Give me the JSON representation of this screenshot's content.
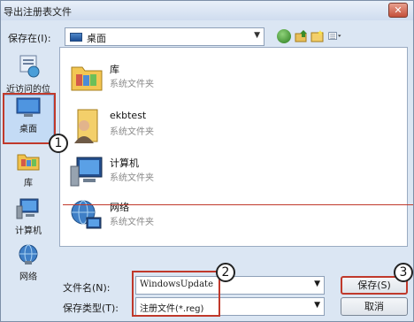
{
  "window": {
    "title": "导出注册表文件"
  },
  "toolbar": {
    "save_in_label": "保存在(I):",
    "save_in_value": "桌面"
  },
  "places": [
    {
      "label": "近访问的位置",
      "icon": "recent-places-icon"
    },
    {
      "label": "桌面",
      "icon": "desktop-icon"
    },
    {
      "label": "库",
      "icon": "library-icon"
    },
    {
      "label": "计算机",
      "icon": "computer-icon"
    },
    {
      "label": "网络",
      "icon": "network-icon"
    }
  ],
  "files": [
    {
      "name": "库",
      "type": "系统文件夹",
      "icon": "library-icon"
    },
    {
      "name": "ekbtest",
      "type": "系统文件夹",
      "icon": "user-folder-icon"
    },
    {
      "name": "计算机",
      "type": "系统文件夹",
      "icon": "computer-icon"
    },
    {
      "name": "网络",
      "type": "系统文件夹",
      "icon": "network-icon"
    }
  ],
  "form": {
    "filename_label": "文件名(N):",
    "filename_value": "WindowsUpdate",
    "type_label": "保存类型(T):",
    "type_value": "注册文件(*.reg)"
  },
  "buttons": {
    "save": "保存(S)",
    "cancel": "取消"
  },
  "annotations": {
    "marker1": "1",
    "marker2": "2",
    "marker3": "3"
  },
  "colors": {
    "highlight": "#c0392b",
    "selection": "#c4dbf5"
  }
}
